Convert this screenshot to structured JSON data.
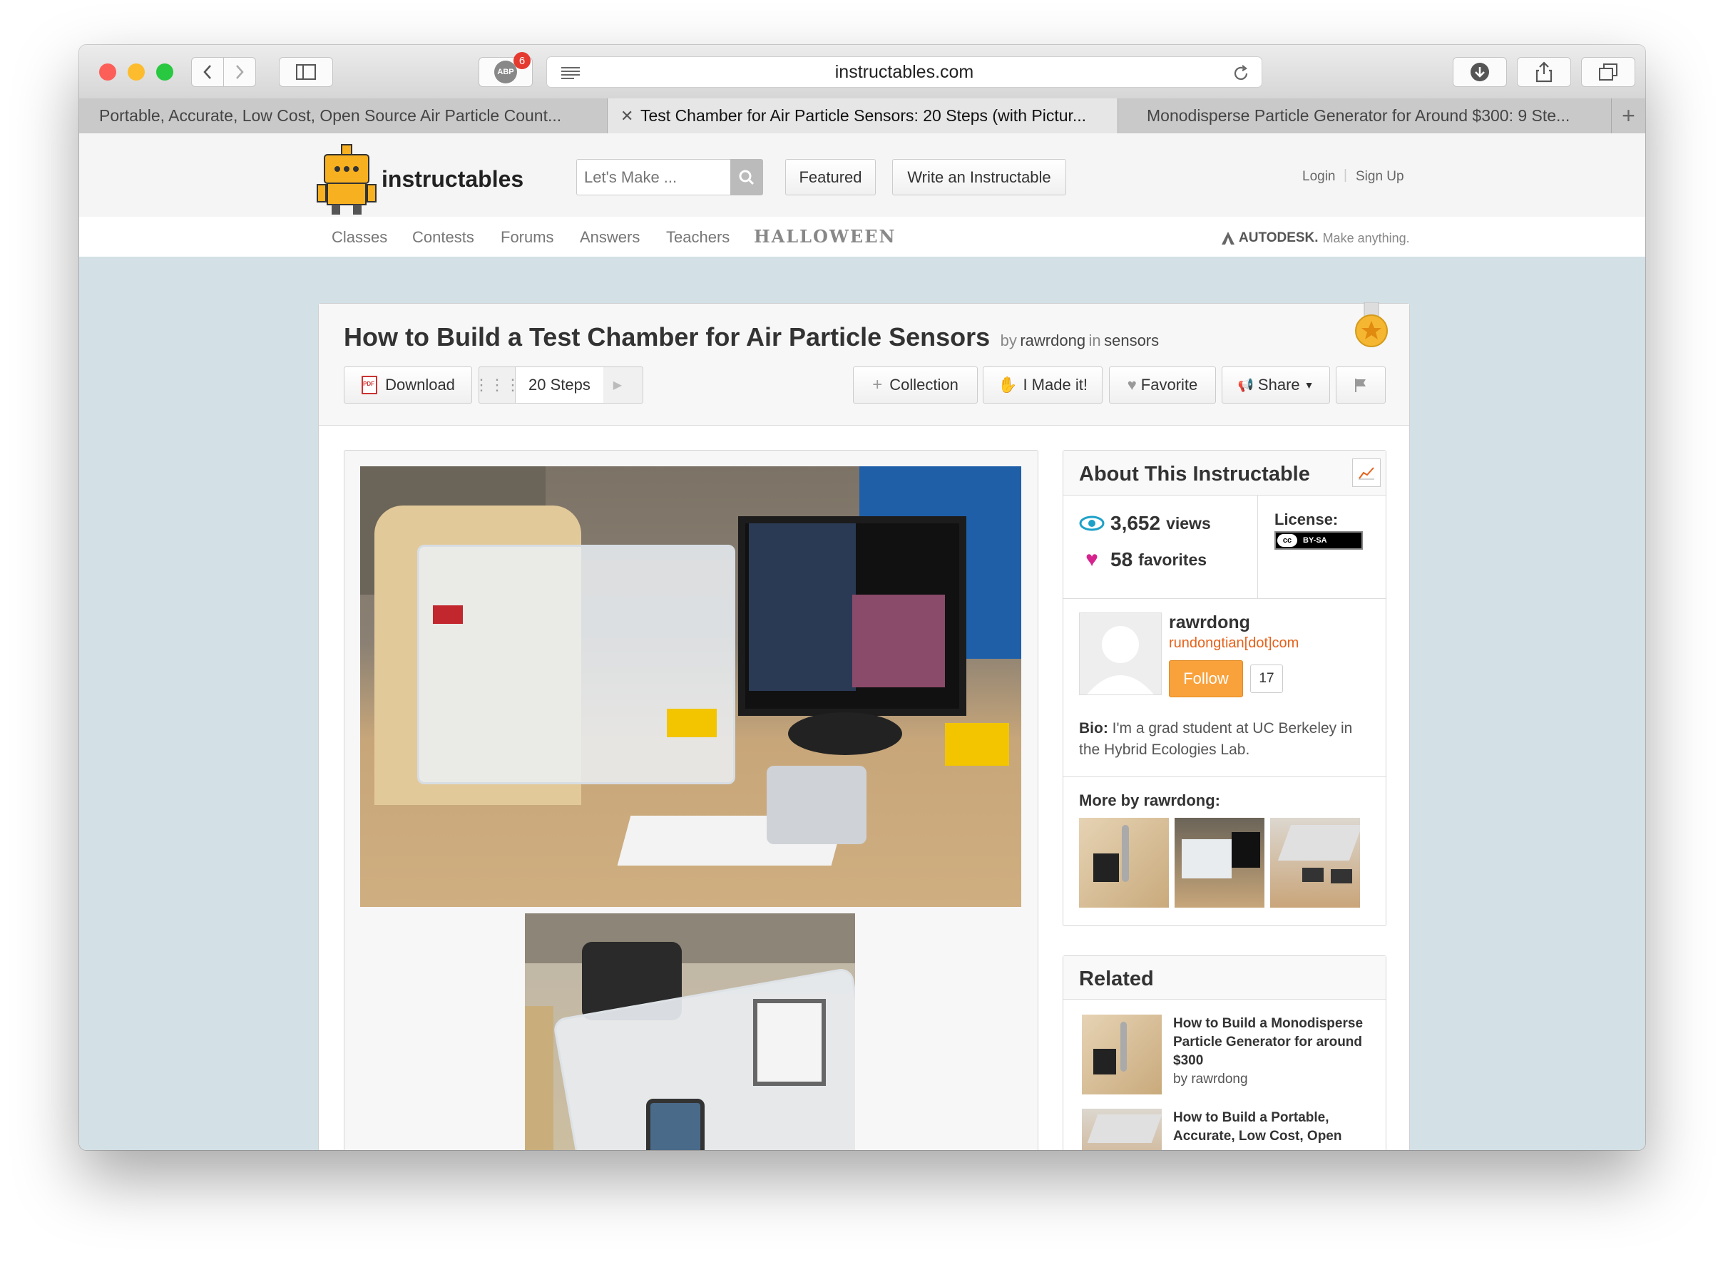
{
  "browser": {
    "address": "instructables.com",
    "adblock_badge": "6",
    "adblock_label": "ABP",
    "tabs": [
      {
        "label": "Portable, Accurate, Low Cost, Open Source Air Particle Count..."
      },
      {
        "label": "Test Chamber for Air Particle Sensors: 20 Steps (with Pictur..."
      },
      {
        "label": "Monodisperse Particle Generator for Around $300: 9 Ste..."
      }
    ],
    "new_tab": "+"
  },
  "site": {
    "logo_text": "instructables",
    "search_placeholder": "Let's Make ...",
    "featured_label": "Featured",
    "write_label": "Write an Instructable",
    "login_label": "Login",
    "signup_label": "Sign Up",
    "nav": [
      "Classes",
      "Contests",
      "Forums",
      "Answers",
      "Teachers",
      "HALLOWEEN"
    ],
    "autodesk_brand": "AUTODESK.",
    "autodesk_tagline": "Make anything."
  },
  "article": {
    "title": "How to Build a Test Chamber for Air Particle Sensors",
    "by_prefix": "by",
    "author": "rawrdong",
    "in_word": "in",
    "category": "sensors",
    "download_label": "Download",
    "steps_label": "20 Steps",
    "collection_label": "Collection",
    "made_it_label": "I Made it!",
    "favorite_label": "Favorite",
    "share_label": "Share"
  },
  "about": {
    "heading": "About This Instructable",
    "views_count": "3,652",
    "views_label": "views",
    "favorites_count": "58",
    "favorites_label": "favorites",
    "license_label": "License:",
    "license_badge": "BY-SA",
    "author_name": "rawrdong",
    "author_site": "rundongtian[dot]com",
    "follow_label": "Follow",
    "followers": "17",
    "bio_label": "Bio:",
    "bio_text": "I'm a grad student at UC Berkeley in the Hybrid Ecologies Lab.",
    "more_by": "More by rawrdong:"
  },
  "related": {
    "heading": "Related",
    "items": [
      {
        "title": "How to Build a Monodisperse Particle Generator for around $300",
        "by": "by rawrdong"
      },
      {
        "title": "How to Build a Portable, Accurate, Low Cost, Open",
        "by": ""
      }
    ]
  },
  "colors": {
    "accent_orange": "#f9a23c",
    "link_orange": "#e5621b",
    "view_blue": "#1da1c8",
    "heart_magenta": "#d6238d",
    "page_bg": "#d3e0e6"
  }
}
